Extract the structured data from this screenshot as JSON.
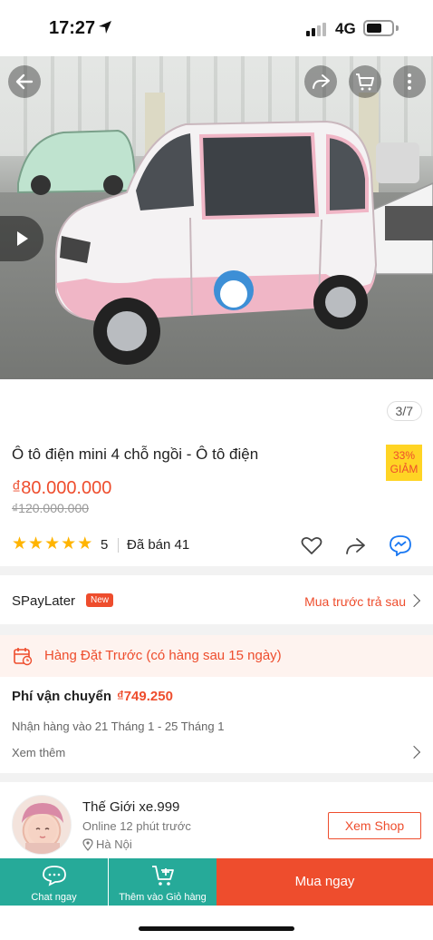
{
  "status_bar": {
    "time": "17:27",
    "network": "4G"
  },
  "gallery": {
    "page_counter": "3/7"
  },
  "product": {
    "title": "Ô tô điện mini 4 chỗ ngồi - Ô tô điện",
    "discount_percent": "33%",
    "discount_label": "GIẢM",
    "price": "₫80.000.000",
    "original_price": "₫120.000.000",
    "rating": "5",
    "stars": 5,
    "sold": "Đã bán 41"
  },
  "spaylater": {
    "label": "SPayLater",
    "badge": "New",
    "cta": "Mua trước trả sau"
  },
  "preorder": {
    "text": "Hàng Đặt Trước (có hàng sau 15 ngày)"
  },
  "shipping": {
    "fee_label": "Phí vận chuyển",
    "fee": "₫749.250",
    "delivery": "Nhận hàng vào 21 Tháng 1 - 25 Tháng 1",
    "see_more": "Xem thêm"
  },
  "shop": {
    "name": "Thế Giới xe.999",
    "online": "Online 12 phút trước",
    "location": "Hà Nội",
    "view_shop": "Xem Shop"
  },
  "bottom_bar": {
    "chat": "Chat ngay",
    "add_to_cart": "Thêm vào Giỏ hàng",
    "buy_now": "Mua ngay"
  },
  "colors": {
    "accent": "#ee4d2d",
    "teal": "#26aa99",
    "badge_yellow": "#ffd424",
    "star": "#ffb400"
  },
  "icons": [
    "location-arrow-icon",
    "back-arrow-icon",
    "share-icon",
    "cart-icon",
    "more-icon",
    "play-icon",
    "heart-icon",
    "messenger-icon",
    "calendar-icon",
    "chevron-right-icon",
    "map-pin-icon",
    "chat-icon",
    "add-cart-icon"
  ]
}
